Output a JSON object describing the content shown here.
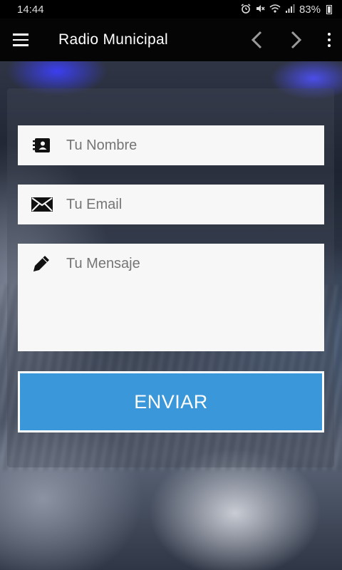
{
  "status_bar": {
    "time": "14:44",
    "icons": [
      "alarm-icon",
      "mute-icon",
      "wifi-icon",
      "signal-icon"
    ],
    "battery_percent": "83%"
  },
  "app_bar": {
    "title": "Radio Municipal",
    "icons": [
      "menu-icon",
      "chevron-left-icon",
      "chevron-right-icon",
      "more-vert-icon"
    ]
  },
  "form": {
    "name_placeholder": "Tu Nombre",
    "email_placeholder": "Tu Email",
    "message_placeholder": "Tu Mensaje",
    "submit_label": "ENVIAR",
    "icons": [
      "contact-card-icon",
      "envelope-icon",
      "pencil-icon"
    ]
  },
  "colors": {
    "app_bar": "#050505",
    "submit_button": "#3a97d9",
    "field_background": "#f7f7f7"
  }
}
